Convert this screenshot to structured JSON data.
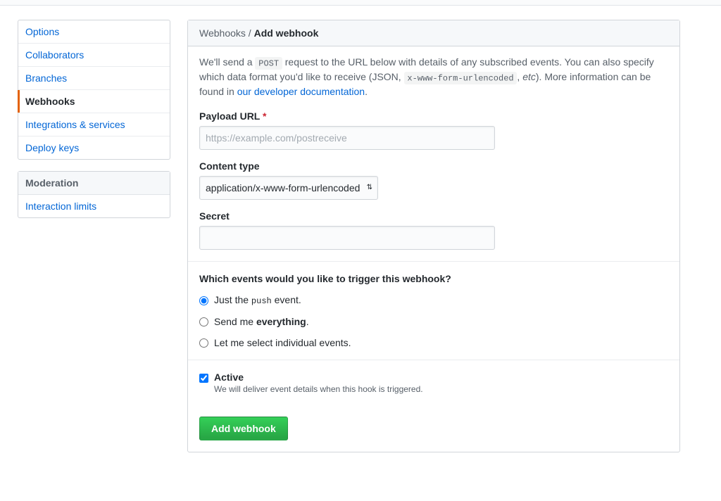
{
  "sidebar": {
    "menu1": [
      {
        "label": "Options",
        "selected": false
      },
      {
        "label": "Collaborators",
        "selected": false
      },
      {
        "label": "Branches",
        "selected": false
      },
      {
        "label": "Webhooks",
        "selected": true
      },
      {
        "label": "Integrations & services",
        "selected": false
      },
      {
        "label": "Deploy keys",
        "selected": false
      }
    ],
    "menu2_heading": "Moderation",
    "menu2": [
      {
        "label": "Interaction limits",
        "selected": false
      }
    ]
  },
  "breadcrumb": {
    "parent": "Webhooks",
    "separator": " / ",
    "current": "Add webhook"
  },
  "intro": {
    "part1": "We'll send a ",
    "code1": "POST",
    "part2": " request to the URL below with details of any subscribed events. You can also specify which data format you'd like to receive (JSON, ",
    "code2": "x-www-form-urlencoded",
    "part3": ", ",
    "em": "etc",
    "part4": "). More information can be found in ",
    "link": "our developer documentation",
    "part5": "."
  },
  "form": {
    "payload_url_label": "Payload URL",
    "payload_url_placeholder": "https://example.com/postreceive",
    "payload_url_value": "",
    "content_type_label": "Content type",
    "content_type_value": "application/x-www-form-urlencoded",
    "secret_label": "Secret",
    "secret_value": ""
  },
  "events": {
    "heading": "Which events would you like to trigger this webhook?",
    "options": [
      {
        "pre": "Just the ",
        "code": "push",
        "post": " event.",
        "checked": true
      },
      {
        "pre": "Send me ",
        "strong": "everything",
        "post": ".",
        "checked": false
      },
      {
        "pre": "Let me select individual events.",
        "checked": false
      }
    ]
  },
  "active": {
    "label": "Active",
    "note": "We will deliver event details when this hook is triggered.",
    "checked": true
  },
  "submit": {
    "label": "Add webhook"
  }
}
